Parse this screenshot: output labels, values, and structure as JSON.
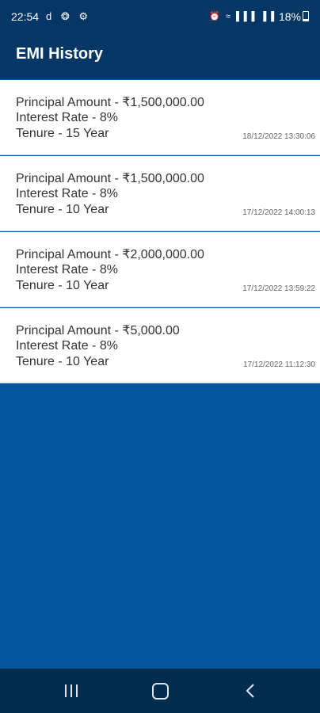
{
  "status_bar": {
    "time": "22:54",
    "left_icons": "d ❂ ⚙",
    "right_icons": "⏰ ≈ ▌▌▌ ▌▌",
    "battery": "18%"
  },
  "app_bar": {
    "title": "EMI History"
  },
  "history": [
    {
      "principal": "Principal Amount - ₹1,500,000.00",
      "rate": "Interest Rate - 8%",
      "tenure": "Tenure - 15 Year",
      "date": "18/12/2022 13:30:06"
    },
    {
      "principal": "Principal Amount - ₹1,500,000.00",
      "rate": "Interest Rate - 8%",
      "tenure": "Tenure - 10 Year",
      "date": "17/12/2022 14:00:13"
    },
    {
      "principal": "Principal Amount - ₹2,000,000.00",
      "rate": "Interest Rate - 8%",
      "tenure": "Tenure - 10 Year",
      "date": "17/12/2022 13:59:22"
    },
    {
      "principal": "Principal Amount - ₹5,000.00",
      "rate": "Interest Rate - 8%",
      "tenure": "Tenure - 10 Year",
      "date": "17/12/2022 11:12:30"
    }
  ],
  "nav_bar": {
    "icons": [
      "recent-apps-icon",
      "home-icon",
      "back-icon"
    ]
  },
  "colors": {
    "app_bar": "#043666",
    "background": "#02549f",
    "card": "#ffffff",
    "nav_bar": "#032c51"
  }
}
